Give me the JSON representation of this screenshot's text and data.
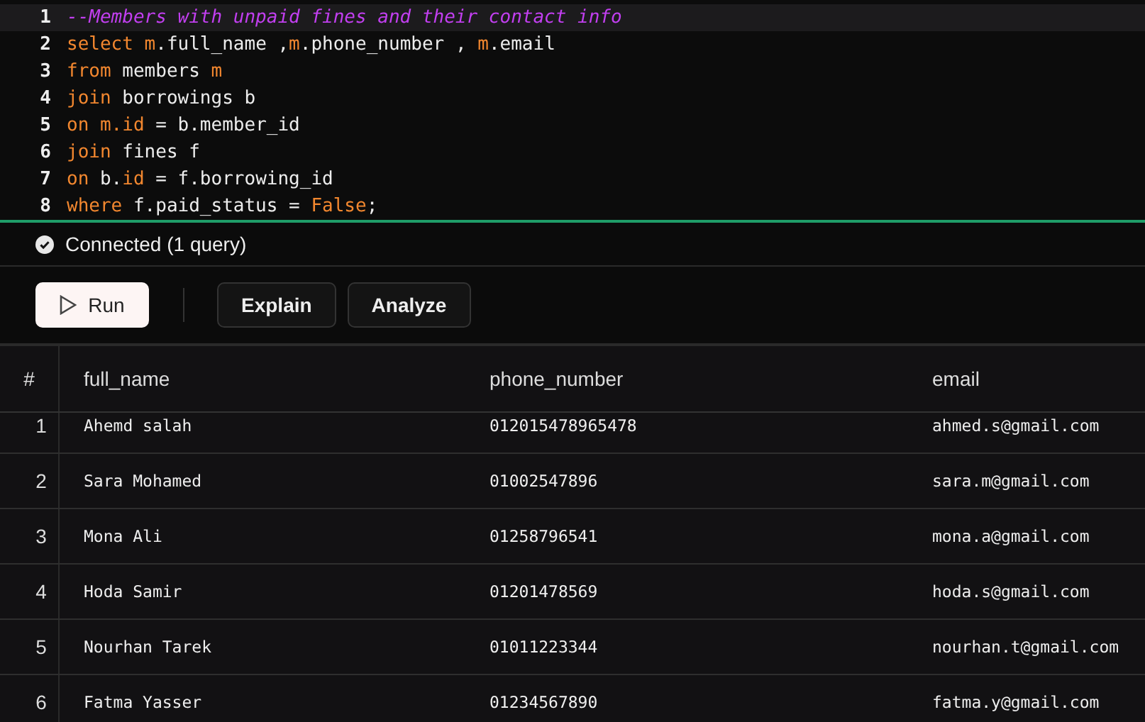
{
  "editor": {
    "lines": [
      {
        "number": "1",
        "active": true,
        "tokens": [
          {
            "kind": "comment",
            "text": "--Members with unpaid fines and their contact info"
          }
        ]
      },
      {
        "number": "2",
        "active": false,
        "tokens": [
          {
            "kind": "keyword",
            "text": "select "
          },
          {
            "kind": "keyword",
            "text": "m"
          },
          {
            "kind": "plain",
            "text": ".full_name ,"
          },
          {
            "kind": "keyword",
            "text": "m"
          },
          {
            "kind": "plain",
            "text": ".phone_number , "
          },
          {
            "kind": "keyword",
            "text": "m"
          },
          {
            "kind": "plain",
            "text": ".email"
          }
        ]
      },
      {
        "number": "3",
        "active": false,
        "tokens": [
          {
            "kind": "keyword",
            "text": "from"
          },
          {
            "kind": "plain",
            "text": " members "
          },
          {
            "kind": "keyword",
            "text": "m"
          }
        ]
      },
      {
        "number": "4",
        "active": false,
        "tokens": [
          {
            "kind": "keyword",
            "text": "join"
          },
          {
            "kind": "plain",
            "text": " borrowings b"
          }
        ]
      },
      {
        "number": "5",
        "active": false,
        "tokens": [
          {
            "kind": "keyword",
            "text": "on "
          },
          {
            "kind": "keyword",
            "text": "m.id"
          },
          {
            "kind": "plain",
            "text": " = b.member_id"
          }
        ]
      },
      {
        "number": "6",
        "active": false,
        "tokens": [
          {
            "kind": "keyword",
            "text": "join"
          },
          {
            "kind": "plain",
            "text": " fines f"
          }
        ]
      },
      {
        "number": "7",
        "active": false,
        "tokens": [
          {
            "kind": "keyword",
            "text": "on"
          },
          {
            "kind": "plain",
            "text": " b."
          },
          {
            "kind": "keyword",
            "text": "id"
          },
          {
            "kind": "plain",
            "text": " = f.borrowing_id"
          }
        ]
      },
      {
        "number": "8",
        "active": false,
        "tokens": [
          {
            "kind": "keyword",
            "text": "where"
          },
          {
            "kind": "plain",
            "text": " f.paid_status = "
          },
          {
            "kind": "keyword",
            "text": "False"
          },
          {
            "kind": "plain",
            "text": ";"
          }
        ]
      }
    ]
  },
  "status": {
    "text": "Connected (1 query)"
  },
  "toolbar": {
    "buttons": [
      {
        "label": "Run",
        "kind": "primary"
      },
      {
        "label": "Explain",
        "kind": "secondary"
      },
      {
        "label": "Analyze",
        "kind": "secondary"
      }
    ]
  },
  "table": {
    "columns": [
      "#",
      "full_name",
      "phone_number",
      "email"
    ],
    "rows": [
      [
        "1",
        "Ahemd salah",
        "012015478965478",
        "ahmed.s@gmail.com"
      ],
      [
        "2",
        "Sara Mohamed",
        "01002547896",
        "sara.m@gmail.com"
      ],
      [
        "3",
        "Mona Ali",
        "01258796541",
        "mona.a@gmail.com"
      ],
      [
        "4",
        "Hoda Samir",
        "01201478569",
        "hoda.s@gmail.com"
      ],
      [
        "5",
        "Nourhan Tarek",
        "01011223344",
        "nourhan.t@gmail.com"
      ],
      [
        "6",
        "Fatma Yasser",
        "01234567890",
        "fatma.y@gmail.com"
      ]
    ]
  }
}
